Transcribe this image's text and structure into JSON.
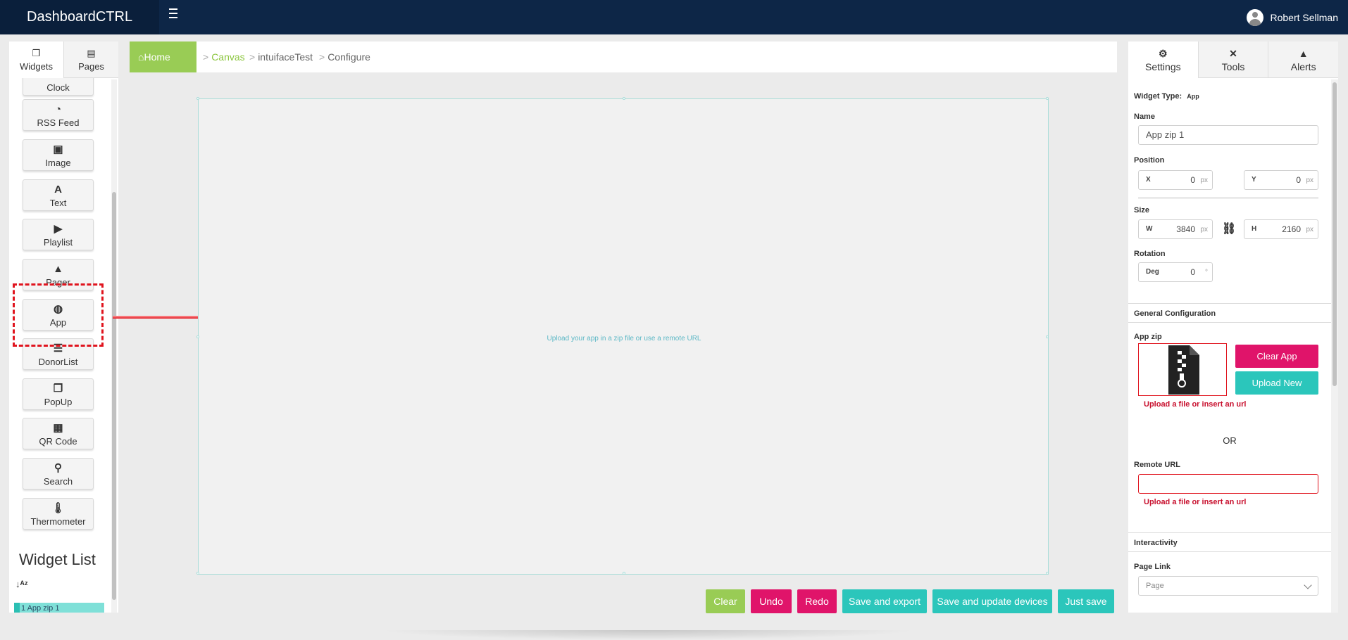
{
  "app": {
    "brand": "DashboardCTRL",
    "user_name": "Robert Sellman"
  },
  "left_tabs": [
    {
      "label": "Widgets",
      "icon": "widgets-icon"
    },
    {
      "label": "Pages",
      "icon": "file-icon"
    }
  ],
  "widgets": [
    {
      "label": "Clock",
      "icon": "clock-icon",
      "glyph": ""
    },
    {
      "label": "RSS Feed",
      "icon": "rss-icon",
      "glyph": "◔"
    },
    {
      "label": "Image",
      "icon": "image-icon",
      "glyph": "▣"
    },
    {
      "label": "Text",
      "icon": "text-icon",
      "glyph": "A"
    },
    {
      "label": "Playlist",
      "icon": "play-circle-icon",
      "glyph": "▶"
    },
    {
      "label": "Pager",
      "icon": "warning-icon",
      "glyph": "▲"
    },
    {
      "label": "App",
      "icon": "globe-icon",
      "glyph": "◍"
    },
    {
      "label": "DonorList",
      "icon": "list-icon",
      "glyph": "☰"
    },
    {
      "label": "PopUp",
      "icon": "copy-icon",
      "glyph": "❐"
    },
    {
      "label": "QR Code",
      "icon": "qr-code-icon",
      "glyph": "▦"
    },
    {
      "label": "Search",
      "icon": "search-icon",
      "glyph": "⚲"
    },
    {
      "label": "Thermometer",
      "icon": "thermometer-icon",
      "glyph": "🌡"
    }
  ],
  "widget_list": {
    "title": "Widget List",
    "items": [
      {
        "label": "1 App zip 1"
      }
    ]
  },
  "breadcrumb": {
    "home": "Home",
    "items": [
      "Canvas",
      "intuifaceTest",
      "Configure"
    ]
  },
  "canvas": {
    "hint": "Upload your app in a zip file or use a remote URL"
  },
  "actions": {
    "clear": "Clear",
    "undo": "Undo",
    "redo": "Redo",
    "save_export": "Save and export",
    "save_update": "Save and update devices",
    "just_save": "Just save"
  },
  "right_tabs": [
    {
      "label": "Settings",
      "icon": "gear-icon"
    },
    {
      "label": "Tools",
      "icon": "tools-icon"
    },
    {
      "label": "Alerts",
      "icon": "warning-icon"
    }
  ],
  "settings": {
    "widget_type_label": "Widget Type:",
    "widget_type_value": "App",
    "name_label": "Name",
    "name_value": "App zip 1",
    "position_label": "Position",
    "x_prefix": "X",
    "x_value": "0",
    "y_prefix": "Y",
    "y_value": "0",
    "px": "px",
    "size_label": "Size",
    "w_prefix": "W",
    "w_value": "3840",
    "h_prefix": "H",
    "h_value": "2160",
    "rotation_label": "Rotation",
    "deg_prefix": "Deg",
    "deg_value": "0",
    "deg_unit": "°",
    "general_config": "General Configuration",
    "app_zip_label": "App zip",
    "clear_app": "Clear App",
    "upload_new": "Upload New",
    "upload_error": "Upload a file or insert an url",
    "or": "OR",
    "remote_url_label": "Remote URL",
    "remote_url_value": "",
    "interactivity": "Interactivity",
    "page_link_label": "Page Link",
    "page_link_placeholder": "Page"
  },
  "colors": {
    "topbar": "#0d2647",
    "green": "#99cc55",
    "pink": "#e0146a",
    "teal": "#2bc6bb",
    "error": "#c8102e"
  }
}
